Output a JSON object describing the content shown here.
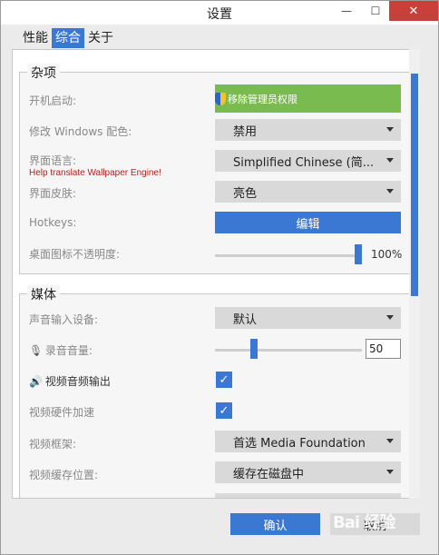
{
  "window": {
    "title": "设置",
    "minimize_glyph": "—",
    "maximize_glyph": "☐",
    "close_glyph": "✕"
  },
  "tabs": [
    {
      "label": "性能",
      "active": false
    },
    {
      "label": "综合",
      "active": true
    },
    {
      "label": "关于",
      "active": false
    }
  ],
  "misc": {
    "title": "杂项",
    "startup": {
      "label": "开机启动:",
      "button": "移除管理员权限"
    },
    "windows_color": {
      "label": "修改 Windows 配色:",
      "value": "禁用"
    },
    "ui_language": {
      "label": "界面语言:",
      "help": "Help translate Wallpaper Engine!",
      "value": "Simplified Chinese (简..."
    },
    "ui_skin": {
      "label": "界面皮肤:",
      "value": "亮色"
    },
    "hotkeys": {
      "label": "Hotkeys:",
      "button": "编辑"
    },
    "icon_opacity": {
      "label": "桌面图标不透明度:",
      "value_text": "100%",
      "value": 100
    }
  },
  "media": {
    "title": "媒体",
    "audio_input": {
      "label": "声音输入设备:",
      "value": "默认"
    },
    "record_volume": {
      "label": "录音音量:",
      "value": "50",
      "level": 0.5
    },
    "video_audio_output": {
      "label": "视频音频输出",
      "checked": true
    },
    "video_hw_accel": {
      "label": "视频硬件加速",
      "checked": true
    },
    "video_framework": {
      "label": "视频框架:",
      "value": "首选 Media Foundation"
    },
    "video_cache": {
      "label": "视频缓存位置:",
      "value": "缓存在磁盘中"
    }
  },
  "footer": {
    "ok": "确认",
    "cancel": "取消"
  },
  "watermark": "Bai 经验",
  "colors": {
    "accent": "#3a78d4",
    "green": "#79bb4e",
    "close_red": "#c7403a",
    "help_red": "#b0221e"
  }
}
